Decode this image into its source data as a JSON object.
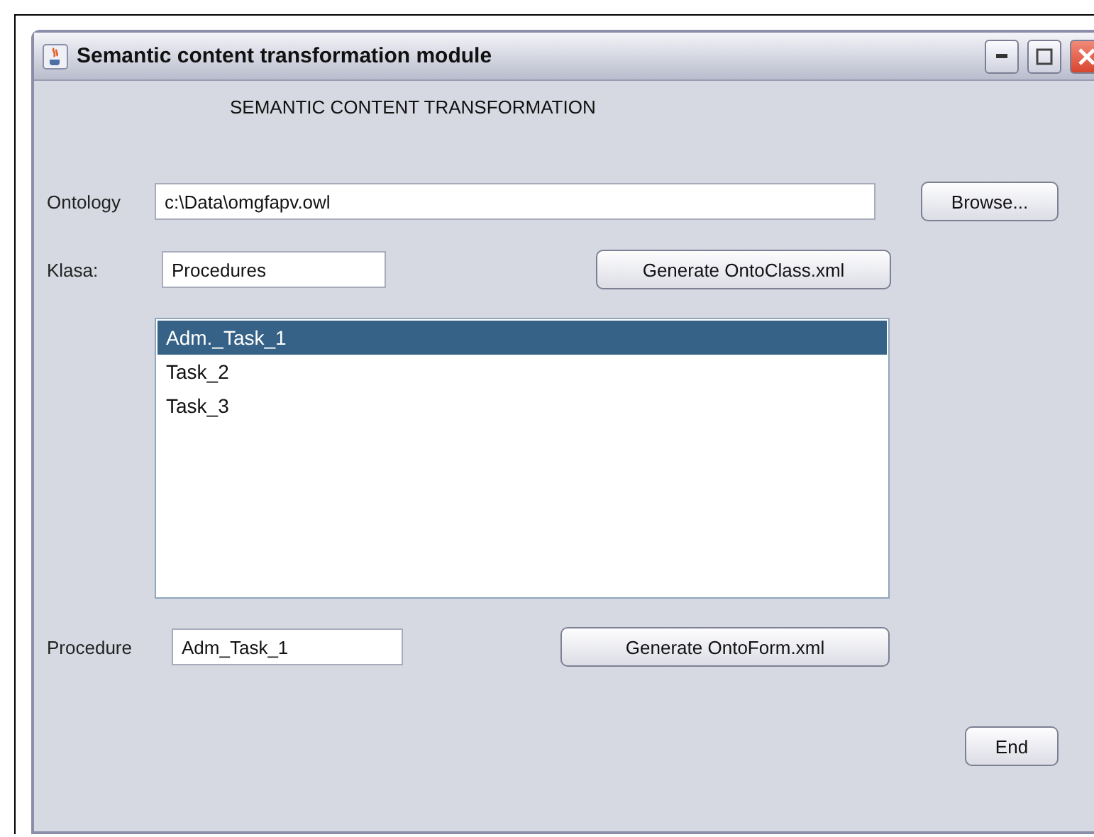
{
  "window": {
    "title": "Semantic content transformation module"
  },
  "heading": "SEMANTIC CONTENT TRANSFORMATION",
  "ontology": {
    "label": "Ontology",
    "value": "c:\\Data\\omgfapv.owl",
    "button": "Browse..."
  },
  "klasa": {
    "label": "Klasa:",
    "value": "Procedures",
    "button": "Generate OntoClass.xml"
  },
  "list_items": [
    {
      "text": "Adm._Task_1",
      "selected": true
    },
    {
      "text": "Task_2",
      "selected": false
    },
    {
      "text": "Task_3",
      "selected": false
    }
  ],
  "procedure": {
    "label": "Procedure",
    "value": "Adm_Task_1",
    "button": "Generate OntoForm.xml"
  },
  "end_button": "End"
}
